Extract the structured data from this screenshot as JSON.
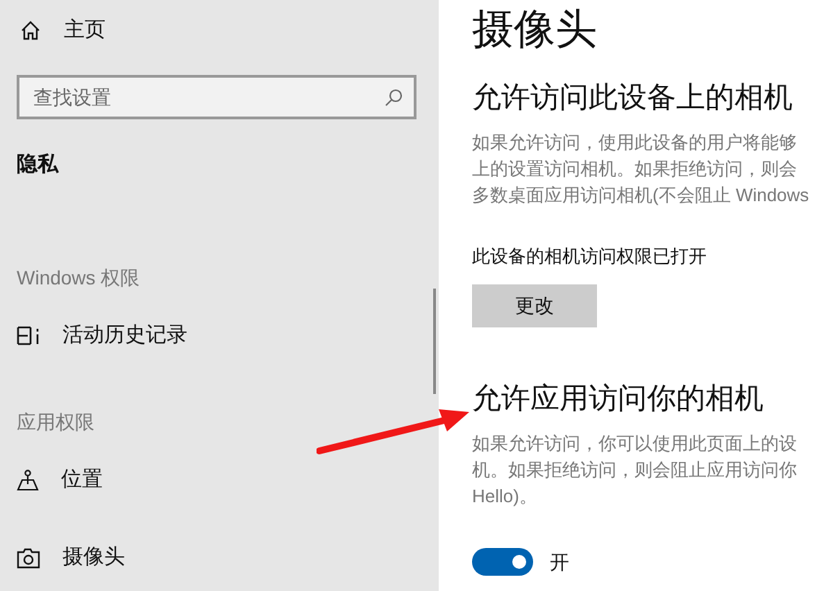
{
  "sidebar": {
    "home": {
      "label": "主页"
    },
    "search": {
      "placeholder": "查找设置"
    },
    "heading": "隐私",
    "groups": [
      {
        "title": "Windows 权限",
        "items": [
          {
            "label": "活动历史记录",
            "kind": "history"
          }
        ]
      },
      {
        "title": "应用权限",
        "items": [
          {
            "label": "位置",
            "kind": "location"
          },
          {
            "label": "摄像头",
            "kind": "camera"
          }
        ]
      }
    ]
  },
  "page": {
    "title": "摄像头",
    "sections": [
      {
        "heading": "允许访问此设备上的相机",
        "description_lines": [
          "如果允许访问，使用此设备的用户将能够",
          "上的设置访问相机。如果拒绝访问，则会",
          "多数桌面应用访问相机(不会阻止 Windows"
        ],
        "kind": "button",
        "status": "此设备的相机访问权限已打开",
        "button": "更改"
      },
      {
        "heading": "允许应用访问你的相机",
        "description_lines": [
          "如果允许访问，你可以使用此页面上的设",
          "机。如果拒绝访问，则会阻止应用访问你",
          "Hello)。"
        ],
        "kind": "toggle",
        "toggle": {
          "on": true,
          "label": "开"
        }
      }
    ]
  }
}
